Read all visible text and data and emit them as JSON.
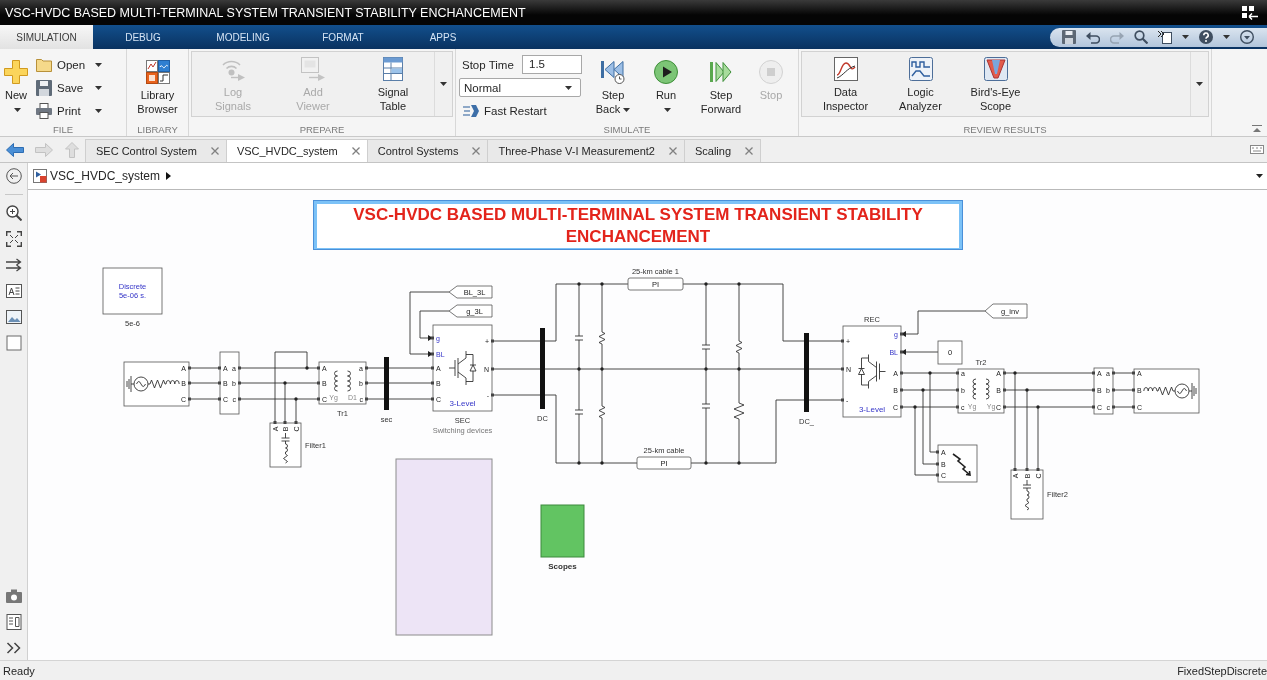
{
  "window": {
    "title": "VSC-HVDC BASED MULTI-TERMINAL SYSTEM TRANSIENT STABILITY ENCHANCEMENT"
  },
  "ribbon_tabs": [
    {
      "label": "SIMULATION",
      "selected": true
    },
    {
      "label": "DEBUG",
      "selected": false
    },
    {
      "label": "MODELING",
      "selected": false
    },
    {
      "label": "FORMAT",
      "selected": false
    },
    {
      "label": "APPS",
      "selected": false
    }
  ],
  "ribbon_groups": [
    {
      "label": "FILE",
      "gallery": false,
      "items": [
        {
          "kind": "large",
          "label": "New",
          "menu": true,
          "disabled": false
        },
        {
          "kind": "small",
          "label": "Open",
          "menu": true,
          "disabled": false
        },
        {
          "kind": "small",
          "label": "Save",
          "menu": true,
          "disabled": false
        },
        {
          "kind": "small",
          "label": "Print",
          "menu": true,
          "disabled": false
        }
      ]
    },
    {
      "label": "LIBRARY",
      "gallery": false,
      "items": [
        {
          "kind": "large",
          "label": "Library Browser",
          "menu": false,
          "disabled": false
        }
      ]
    },
    {
      "label": "PREPARE",
      "gallery": true,
      "items": [
        {
          "kind": "large",
          "label": "Log Signals",
          "menu": false,
          "disabled": true
        },
        {
          "kind": "large",
          "label": "Add Viewer",
          "menu": false,
          "disabled": true
        },
        {
          "kind": "large",
          "label": "Signal Table",
          "menu": false,
          "disabled": false
        }
      ]
    },
    {
      "label": "SIMULATE",
      "gallery": false,
      "items": [
        {
          "kind": "field",
          "label": "Stop Time",
          "value": "1.5"
        },
        {
          "kind": "dropdown",
          "value": "Normal"
        },
        {
          "kind": "small",
          "label": "Fast Restart",
          "menu": false,
          "disabled": false
        },
        {
          "kind": "large",
          "label": "Step Back",
          "menu": true,
          "disabled": false
        },
        {
          "kind": "large",
          "label": "Run",
          "menu": true,
          "disabled": false
        },
        {
          "kind": "large",
          "label": "Step Forward",
          "menu": false,
          "disabled": false
        },
        {
          "kind": "large",
          "label": "Stop",
          "menu": false,
          "disabled": true
        }
      ]
    },
    {
      "label": "REVIEW RESULTS",
      "gallery": true,
      "items": [
        {
          "kind": "large",
          "label": "Data Inspector",
          "menu": false,
          "disabled": false
        },
        {
          "kind": "large",
          "label": "Logic Analyzer",
          "menu": false,
          "disabled": false
        },
        {
          "kind": "large",
          "label": "Bird's-Eye Scope",
          "menu": false,
          "disabled": false
        }
      ]
    }
  ],
  "editor_tabs": [
    {
      "label": "SEC Control System",
      "selected": false
    },
    {
      "label": "VSC_HVDC_system",
      "selected": true
    },
    {
      "label": "Control Systems",
      "selected": false
    },
    {
      "label": "Three-Phase V-I Measurement2",
      "selected": false
    },
    {
      "label": "Scaling",
      "selected": false
    }
  ],
  "breadcrumb": {
    "label": "VSC_HVDC_system"
  },
  "diagram": {
    "annotation": "VSC-HVDC BASED MULTI-TERMINAL SYSTEM TRANSIENT STABILITY ENCHANCEMENT",
    "blocks": [
      {
        "kind": "powergui",
        "lines": [
          "Discrete",
          "5e-06 s."
        ],
        "label": "5e-6"
      },
      {
        "kind": "source",
        "ports": [
          "A",
          "B",
          "C"
        ]
      },
      {
        "kind": "meter",
        "ports": [
          "A",
          "B",
          "C"
        ],
        "outputs": [
          "a",
          "b",
          "c"
        ]
      },
      {
        "kind": "transformer",
        "ports": [
          "A",
          "B",
          "C"
        ],
        "outputs": [
          "a",
          "b",
          "c"
        ],
        "windings": [
          "Yg",
          "D1"
        ],
        "label": "Tr1"
      },
      {
        "kind": "filter",
        "ports": [
          "A",
          "B",
          "C"
        ],
        "label": "Filter1"
      },
      {
        "kind": "bus",
        "label": "sec"
      },
      {
        "kind": "tag",
        "text": "BL_3L"
      },
      {
        "kind": "tag",
        "text": "g_3L"
      },
      {
        "kind": "converter",
        "ports": [
          "g",
          "BL",
          "A",
          "B",
          "C"
        ],
        "outputs": [
          "+",
          "N",
          "-"
        ],
        "caption": "3-Level",
        "label": "SEC",
        "description": "Switching devices"
      },
      {
        "kind": "bus",
        "label": "DC"
      },
      {
        "kind": "cable",
        "text": "PI",
        "label": "25-km cable 1"
      },
      {
        "kind": "cable",
        "text": "PI",
        "label": "25-km cable"
      },
      {
        "kind": "bus",
        "label": "DC_"
      },
      {
        "kind": "converter",
        "ports": [
          "g",
          "BL",
          "A",
          "B",
          "C"
        ],
        "outputs": [
          "+",
          "N",
          "-"
        ],
        "caption": "3-Level",
        "label": "REC"
      },
      {
        "kind": "tag",
        "text": "g_inv"
      },
      {
        "kind": "constant",
        "text": "0"
      },
      {
        "kind": "transformer",
        "ports": [
          "a",
          "b",
          "c"
        ],
        "outputs": [
          "A",
          "B",
          "C"
        ],
        "windings": [
          "Yg",
          "Yg"
        ],
        "label": "Tr2"
      },
      {
        "kind": "fault",
        "ports": [
          "A",
          "B",
          "C"
        ]
      },
      {
        "kind": "filter",
        "ports": [
          "A",
          "B",
          "C"
        ],
        "label": "Filter2"
      },
      {
        "kind": "meter",
        "ports": [
          "A",
          "B",
          "C"
        ],
        "outputs": [
          "a",
          "b",
          "c"
        ]
      },
      {
        "kind": "source",
        "ports": [
          "A",
          "B",
          "C"
        ]
      },
      {
        "kind": "subsystem"
      },
      {
        "kind": "scope",
        "label": "Scopes"
      }
    ]
  },
  "status_bar": {
    "status": "Ready",
    "solver": "FixedStepDiscrete"
  }
}
